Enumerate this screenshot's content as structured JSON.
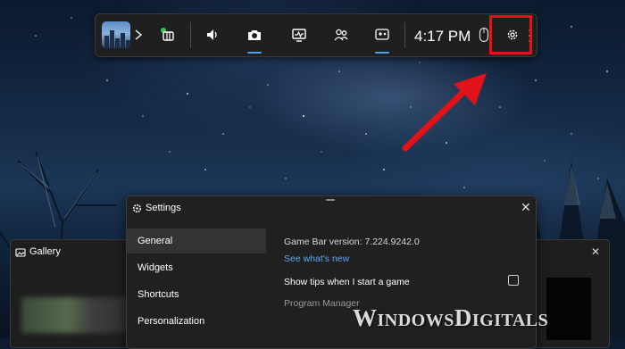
{
  "game_bar": {
    "widgets": [
      {
        "name": "app-thumbnail"
      },
      {
        "name": "widget-menu-icon"
      },
      {
        "name": "xbox-achievements-icon"
      },
      {
        "name": "audio-icon"
      },
      {
        "name": "capture-icon"
      },
      {
        "name": "performance-icon"
      },
      {
        "name": "xbox-social-icon"
      },
      {
        "name": "controller-icon"
      }
    ],
    "time": "4:17 PM",
    "accent_color": "#4ea1e8",
    "highlight_color": "#e0121a"
  },
  "settings": {
    "title": "Settings",
    "nav": [
      {
        "label": "General",
        "active": true
      },
      {
        "label": "Widgets",
        "active": false
      },
      {
        "label": "Shortcuts",
        "active": false
      },
      {
        "label": "Personalization",
        "active": false
      }
    ],
    "version_text": "Game Bar version: 7.224.9242.0",
    "whats_new_link": "See what's new",
    "tips_label": "Show tips when I start a game",
    "tips_checked": false,
    "program_manager": "Program Manager",
    "close_glyph": "✕"
  },
  "gallery": {
    "title": "Gallery",
    "close_glyph": "✕"
  },
  "watermark": {
    "text_w": "W",
    "text_indows": "INDOWS",
    "text_d": "D",
    "text_igitals": "IGITALS"
  }
}
